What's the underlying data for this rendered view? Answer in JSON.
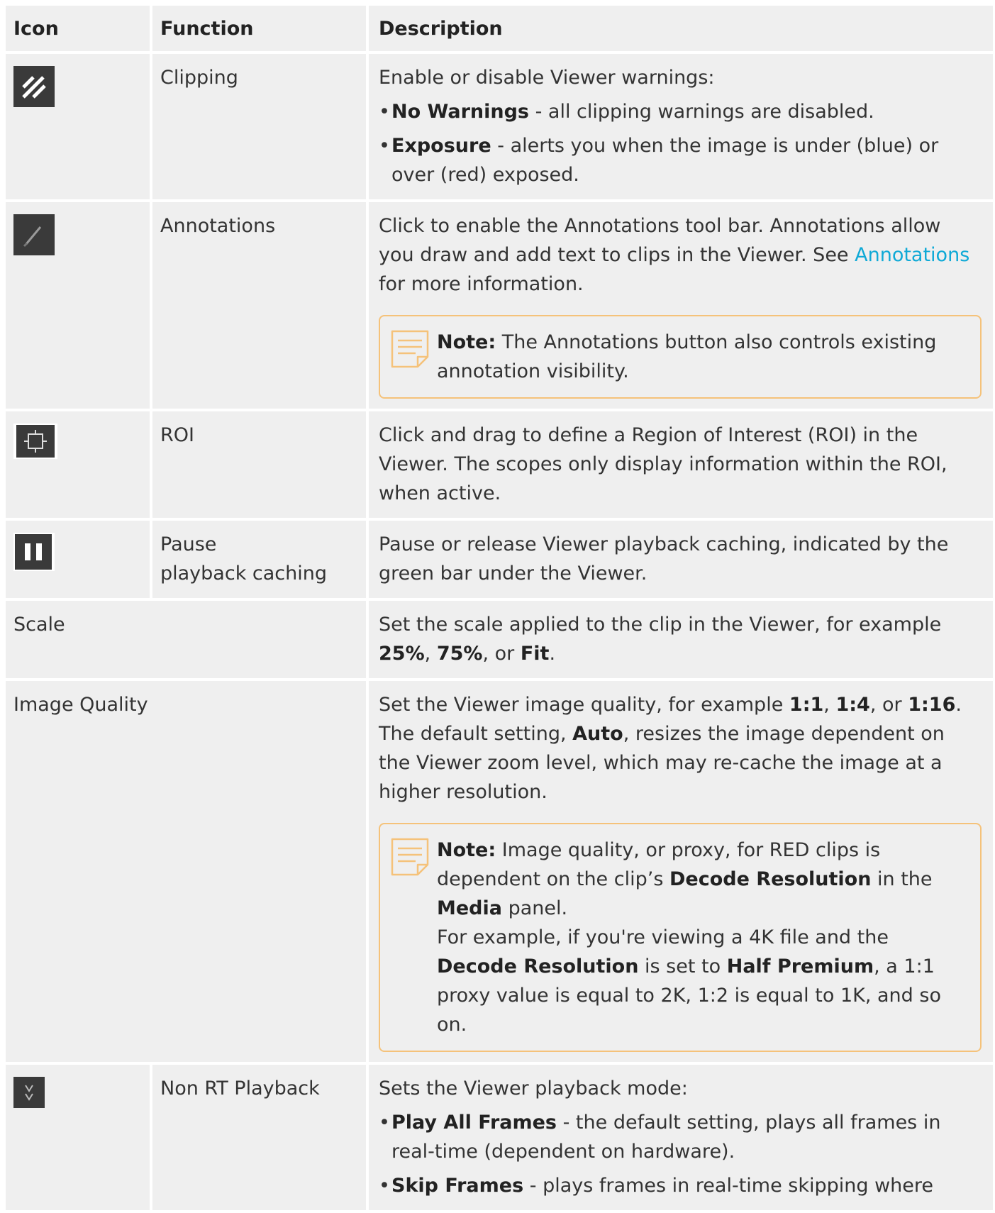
{
  "header": {
    "icon": "Icon",
    "function": "Function",
    "description": "Description"
  },
  "rows": [
    {
      "icon": "clipping-icon",
      "function": "Clipping",
      "intro": "Enable or disable Viewer warnings:",
      "bullets": [
        {
          "term": "No Warnings",
          "text": " - all clipping warnings are disabled."
        },
        {
          "term": "Exposure",
          "text": " - alerts you when the image is under (blue) or over (red) exposed."
        }
      ]
    },
    {
      "icon": "annotations-pen-icon",
      "function": "Annotations",
      "text_a": "Click to enable the Annotations tool bar. Annotations allow you draw and add text to clips in the Viewer. See ",
      "link": "Annotations",
      "text_b": " for more information.",
      "note_label": "Note:",
      "note_text": " The Annotations button also controls existing annotation visibility."
    },
    {
      "icon": "roi-icon",
      "function": "ROI",
      "text": "Click and drag to define a Region of Interest (ROI) in the Viewer. The scopes only display information within the ROI, when active."
    },
    {
      "icon": "pause-icon",
      "function_line1": "Pause",
      "function_line2": "playback caching",
      "text": "Pause or release Viewer playback caching, indicated by the green bar under the Viewer."
    },
    {
      "function": "Scale",
      "t1": "Set the scale applied to the clip in the Viewer, for example ",
      "v1": "25%",
      "t2": ", ",
      "v2": "75%",
      "t3": ", or ",
      "v3": "Fit",
      "t4": "."
    },
    {
      "function": "Image Quality",
      "t1": "Set the Viewer image quality, for example ",
      "v1": "1:1",
      "t2": ", ",
      "v2": "1:4",
      "t3": ", or ",
      "v3": "1:16",
      "t4": ". The default setting, ",
      "v4": "Auto",
      "t5": ", resizes the image dependent on the Viewer zoom level, which may re-cache the image at a higher resolution.",
      "note_label": "Note:",
      "n1": " Image quality, or proxy, for RED clips is dependent on the clip’s ",
      "nb1": "Decode Resolution",
      "n2": " in the ",
      "nb2": "Media",
      "n3": " panel.",
      "n4": "For example, if you're viewing a 4K file and the ",
      "nb3": "Decode Resolution",
      "n5": " is set to ",
      "nb4": "Half Premium",
      "n6": ", a 1:1 proxy value is equal to 2K, 1:2 is equal to 1K, and so on."
    },
    {
      "icon": "non-rt-playback-icon",
      "function": "Non RT Playback",
      "intro": "Sets the Viewer playback mode:",
      "bullets": [
        {
          "term": "Play All Frames",
          "text": " - the default setting, plays all frames in real-time (dependent on hardware)."
        },
        {
          "term": "Skip Frames",
          "text": " - plays frames in real-time skipping where"
        }
      ]
    }
  ],
  "colors": {
    "cell_bg": "#efefef",
    "note_border": "#f5c27a",
    "link": "#0fa9d6",
    "icon_bg": "#3a3a3a"
  }
}
